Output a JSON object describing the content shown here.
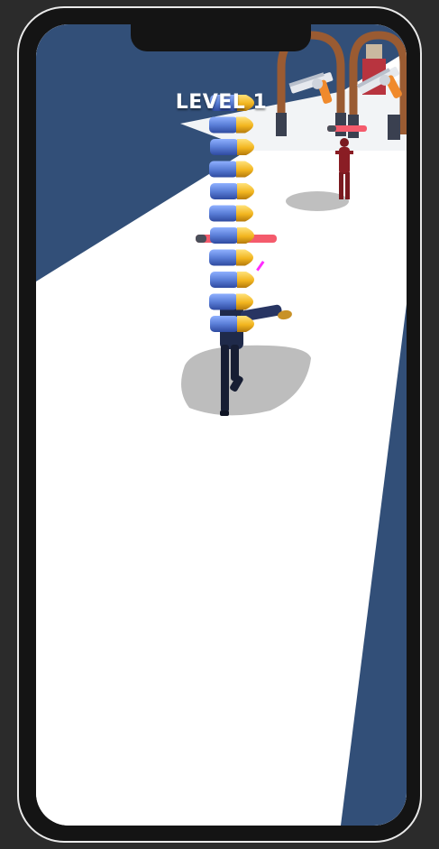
{
  "hud": {
    "level_label": "LEVEL 1"
  },
  "game": {
    "bullet_stack_count": 11,
    "enemy_count": 1,
    "weapon_pickups": [
      "revolver-orange",
      "revolver-white"
    ]
  },
  "colors": {
    "sky": "#324f78",
    "track": "#ffffff",
    "bullet_casing": "#5b7fd8",
    "bullet_tip": "#f2b51f",
    "player_suit": "#1f2a4a",
    "enemy": "#8a1d24",
    "health_bar": "#f45b6c",
    "arch": "#9a5b32"
  }
}
